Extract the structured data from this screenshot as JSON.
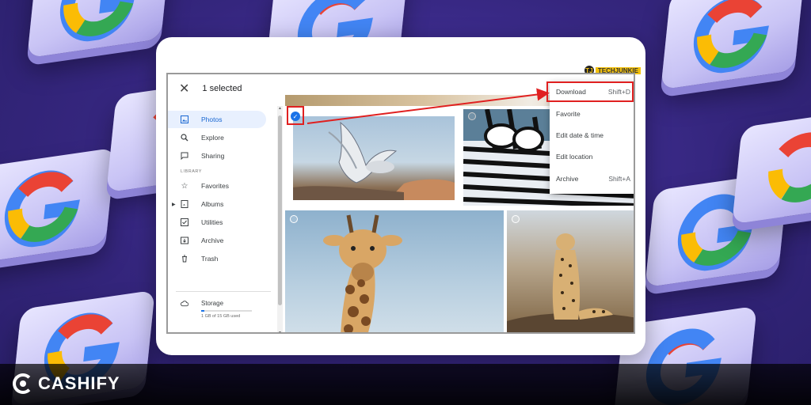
{
  "topbar": {
    "selection_count": "1 selected"
  },
  "sidebar": {
    "items": [
      {
        "label": "Photos"
      },
      {
        "label": "Explore"
      },
      {
        "label": "Sharing"
      }
    ],
    "section_label": "LIBRARY",
    "library_items": [
      {
        "label": "Favorites"
      },
      {
        "label": "Albums"
      },
      {
        "label": "Utilities"
      },
      {
        "label": "Archive"
      },
      {
        "label": "Trash"
      }
    ],
    "storage": {
      "label": "Storage",
      "usage": "1 GB of 15 GB used",
      "fraction": 0.067
    }
  },
  "menu": {
    "items": [
      {
        "label": "Download",
        "shortcut": "Shift+D"
      },
      {
        "label": "Favorite",
        "shortcut": ""
      },
      {
        "label": "Edit date & time",
        "shortcut": ""
      },
      {
        "label": "Edit location",
        "shortcut": ""
      },
      {
        "label": "Archive",
        "shortcut": "Shift+A"
      }
    ]
  },
  "photos": [
    {
      "subject": "dove"
    },
    {
      "subject": "zebras"
    },
    {
      "subject": "giraffe"
    },
    {
      "subject": "cheetah"
    }
  ],
  "watermark": {
    "brand": "TECHJUNKIE",
    "logo_letter": "TJ"
  },
  "footer": {
    "brand": "CASHIFY"
  },
  "colors": {
    "accent": "#1a73e8",
    "highlight": "#e02020",
    "background": "#3b2a8c"
  }
}
